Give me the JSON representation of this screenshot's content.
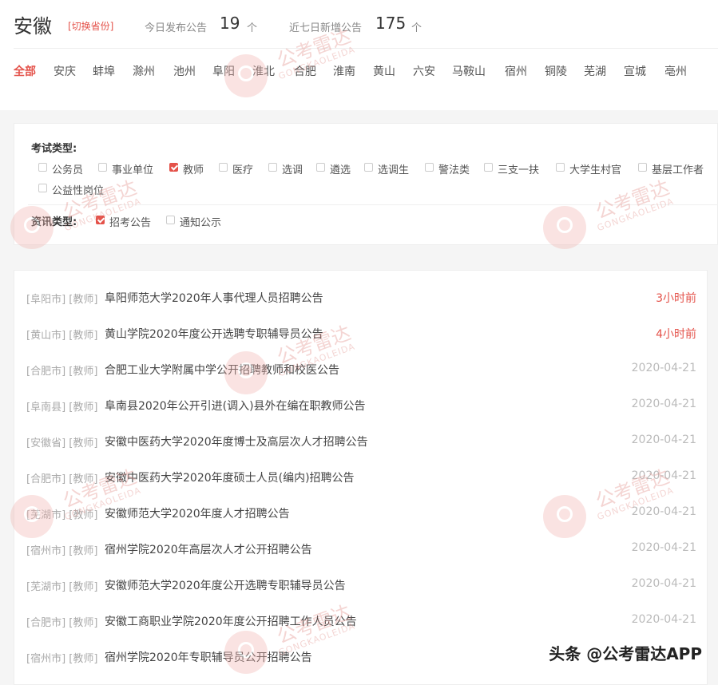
{
  "header": {
    "region": "安徽",
    "switch_label": "[切换省份]",
    "today_label": "今日发布公告",
    "today_count": "19",
    "today_unit": "个",
    "week_label": "近七日新增公告",
    "week_count": "175",
    "week_unit": "个"
  },
  "cities": [
    "全部",
    "安庆",
    "蚌埠",
    "滁州",
    "池州",
    "阜阳",
    "淮北",
    "合肥",
    "淮南",
    "黄山",
    "六安",
    "马鞍山",
    "宿州",
    "铜陵",
    "芜湖",
    "宣城",
    "亳州"
  ],
  "filters": {
    "exam_label": "考试类型:",
    "exam_types": [
      {
        "label": "公务员",
        "checked": false
      },
      {
        "label": "事业单位",
        "checked": false
      },
      {
        "label": "教师",
        "checked": true
      },
      {
        "label": "医疗",
        "checked": false
      },
      {
        "label": "选调",
        "checked": false
      },
      {
        "label": "遴选",
        "checked": false
      },
      {
        "label": "选调生",
        "checked": false
      },
      {
        "label": "警法类",
        "checked": false
      },
      {
        "label": "三支一扶",
        "checked": false
      },
      {
        "label": "大学生村官",
        "checked": false
      },
      {
        "label": "基层工作者",
        "checked": false
      },
      {
        "label": "公益性岗位",
        "checked": false
      }
    ],
    "info_label": "资讯类型:",
    "info_types": [
      {
        "label": "招考公告",
        "checked": true
      },
      {
        "label": "通知公示",
        "checked": false
      }
    ]
  },
  "announcements": [
    {
      "tags": "[阜阳市] [教师]",
      "title": "阜阳师范大学2020年人事代理人员招聘公告",
      "date": "3小时前",
      "recent": true
    },
    {
      "tags": "[黄山市] [教师]",
      "title": "黄山学院2020年度公开选聘专职辅导员公告",
      "date": "4小时前",
      "recent": true
    },
    {
      "tags": "[合肥市] [教师]",
      "title": "合肥工业大学附属中学公开招聘教师和校医公告",
      "date": "2020-04-21",
      "recent": false
    },
    {
      "tags": "[阜南县] [教师]",
      "title": "阜南县2020年公开引进(调入)县外在编在职教师公告",
      "date": "2020-04-21",
      "recent": false
    },
    {
      "tags": "[安徽省] [教师]",
      "title": "安徽中医药大学2020年度博士及高层次人才招聘公告",
      "date": "2020-04-21",
      "recent": false
    },
    {
      "tags": "[合肥市] [教师]",
      "title": "安徽中医药大学2020年度硕士人员(编内)招聘公告",
      "date": "2020-04-21",
      "recent": false
    },
    {
      "tags": "[芜湖市] [教师]",
      "title": "安徽师范大学2020年度人才招聘公告",
      "date": "2020-04-21",
      "recent": false
    },
    {
      "tags": "[宿州市] [教师]",
      "title": "宿州学院2020年高层次人才公开招聘公告",
      "date": "2020-04-21",
      "recent": false
    },
    {
      "tags": "[芜湖市] [教师]",
      "title": "安徽师范大学2020年度公开选聘专职辅导员公告",
      "date": "2020-04-21",
      "recent": false
    },
    {
      "tags": "[合肥市] [教师]",
      "title": "安徽工商职业学院2020年度公开招聘工作人员公告",
      "date": "2020-04-21",
      "recent": false
    },
    {
      "tags": "[宿州市] [教师]",
      "title": "宿州学院2020年专职辅导员公开招聘公告",
      "date": "",
      "recent": false
    }
  ],
  "watermark": {
    "text": "公考雷达",
    "sub": "GONGKAOLEIDA"
  },
  "footer_mark": "头条 @公考雷达APP",
  "colors": {
    "accent": "#e4524a",
    "muted": "#aaaaaa",
    "date": "#bbbbbb"
  }
}
